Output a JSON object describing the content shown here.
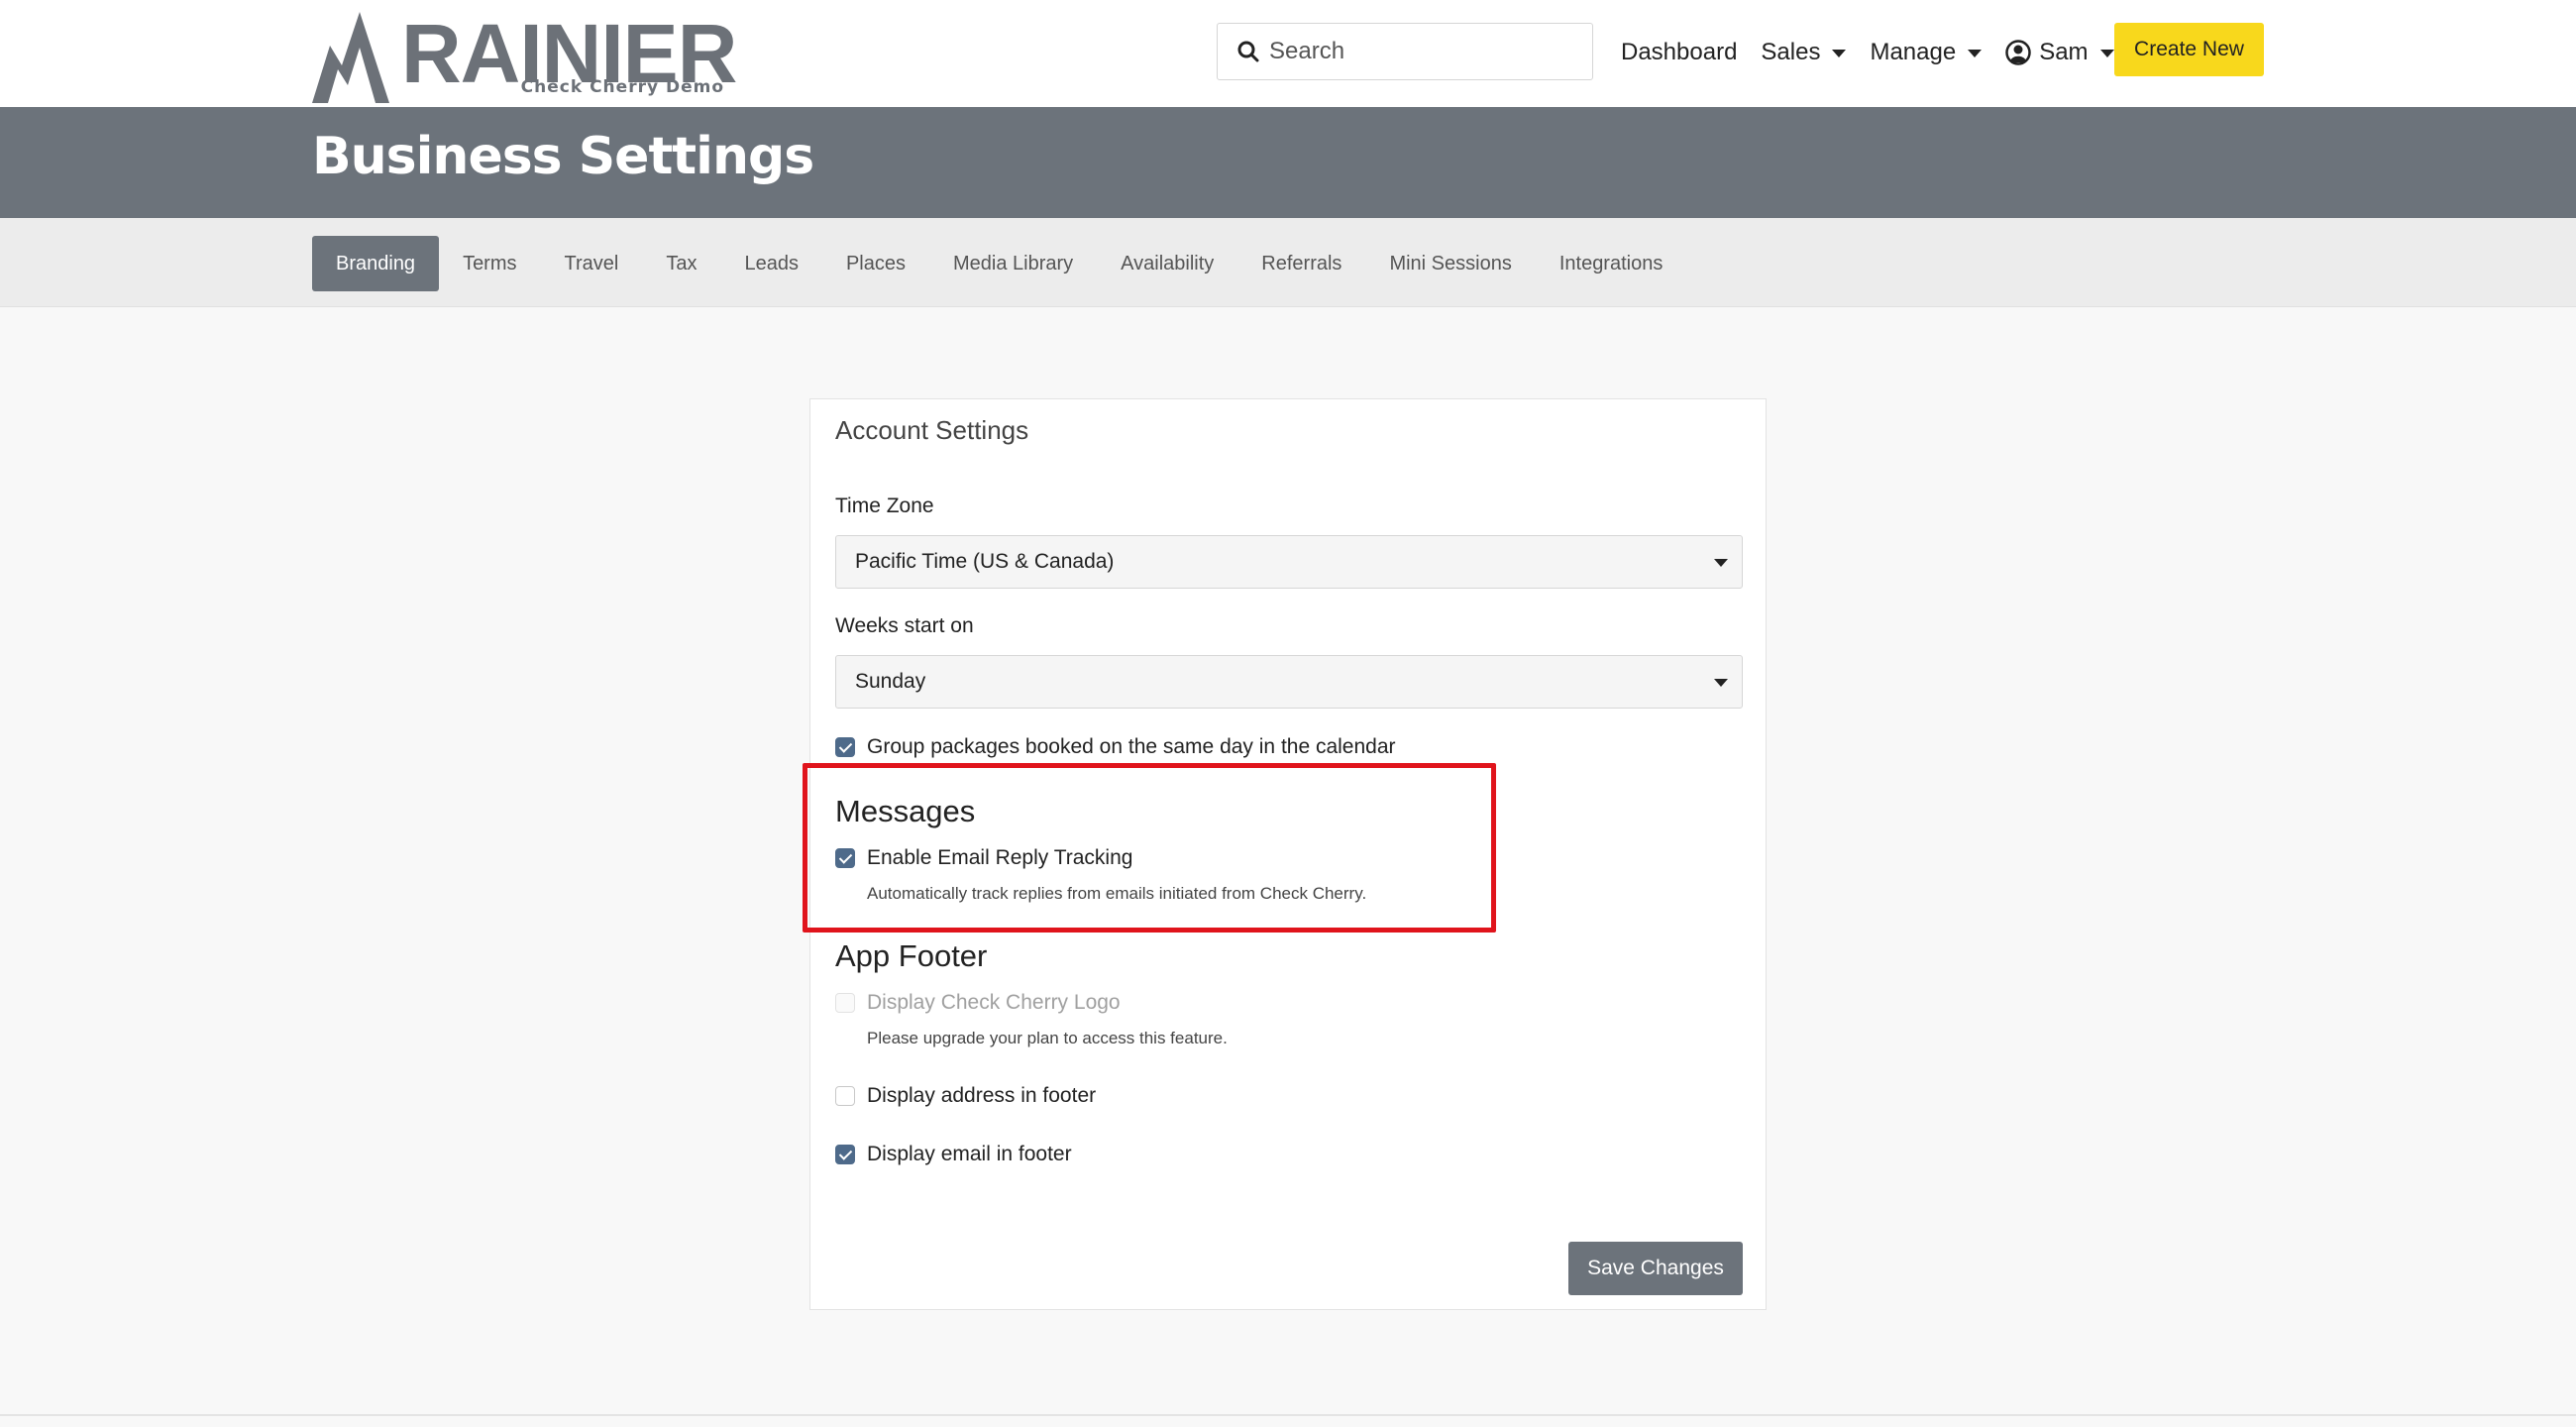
{
  "brand": {
    "name": "RAINIER",
    "tagline": "Check Cherry Demo"
  },
  "nav": {
    "search_placeholder": "Search",
    "links": [
      {
        "label": "Dashboard"
      },
      {
        "label": "Sales"
      },
      {
        "label": "Manage"
      },
      {
        "label": "Sam"
      }
    ],
    "create_label": "Create New"
  },
  "page": {
    "title": "Business Settings"
  },
  "tabs": [
    {
      "label": "Branding",
      "active": true
    },
    {
      "label": "Terms"
    },
    {
      "label": "Travel"
    },
    {
      "label": "Tax"
    },
    {
      "label": "Leads"
    },
    {
      "label": "Places"
    },
    {
      "label": "Media Library"
    },
    {
      "label": "Availability"
    },
    {
      "label": "Referrals"
    },
    {
      "label": "Mini Sessions"
    },
    {
      "label": "Integrations"
    }
  ],
  "card": {
    "title": "Account Settings",
    "time_zone": {
      "label": "Time Zone",
      "value": "Pacific Time (US & Canada)"
    },
    "weeks_start": {
      "label": "Weeks start on",
      "value": "Sunday"
    },
    "group_packages": {
      "label": "Group packages booked on the same day in the calendar",
      "checked": true
    },
    "messages": {
      "title": "Messages",
      "reply_tracking": {
        "label": "Enable Email Reply Tracking",
        "checked": true,
        "help": "Automatically track replies from emails initiated from Check Cherry."
      }
    },
    "app_footer": {
      "title": "App Footer",
      "display_logo": {
        "label": "Display Check Cherry Logo",
        "checked": false,
        "disabled": true,
        "help": "Please upgrade your plan to access this feature."
      },
      "display_address": {
        "label": "Display address in footer",
        "checked": false
      },
      "display_email": {
        "label": "Display email in footer",
        "checked": true
      }
    },
    "save_label": "Save Changes"
  },
  "colors": {
    "brand_gray": "#6c737b",
    "accent_yellow": "#f8d81c",
    "checkbox_blue": "#4e6a8a",
    "highlight_red": "#e0141c"
  }
}
